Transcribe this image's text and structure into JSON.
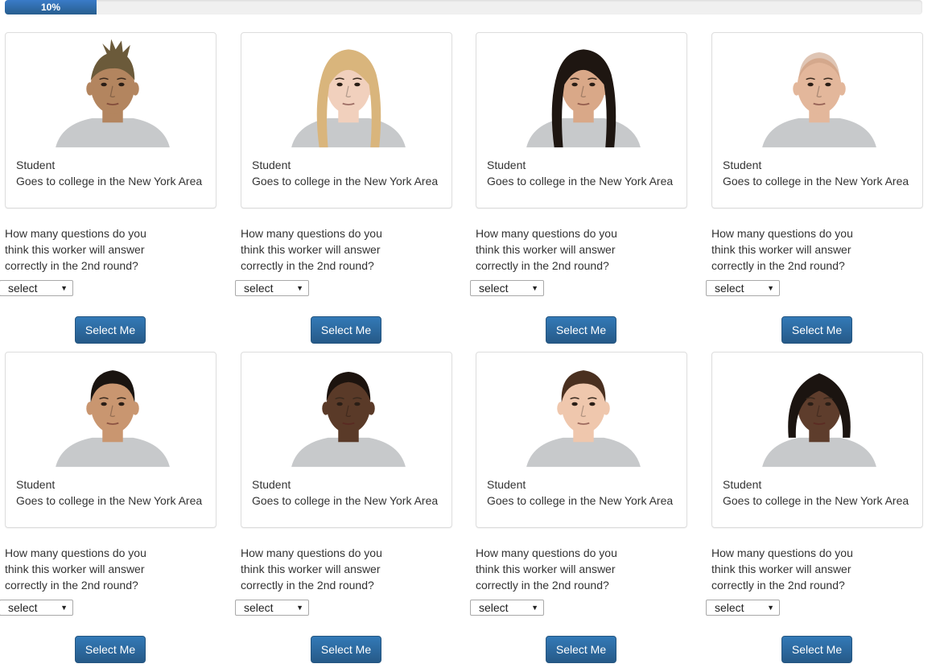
{
  "progress": {
    "label": "10%",
    "value_percent": 10
  },
  "workers": [
    {
      "role": "Student",
      "desc": "Goes to college in the New York Area",
      "question": "How many questions do you think this worker will answer correctly in the 2nd round?",
      "select_value": "select",
      "button_label": "Select Me",
      "skin": "#b3855f",
      "hair": "#6b5a3a",
      "hair_style": "mohawk"
    },
    {
      "role": "Student",
      "desc": "Goes to college in the New York Area",
      "question": "How many questions do you think this worker will answer correctly in the 2nd round?",
      "select_value": "select",
      "button_label": "Select Me",
      "skin": "#f1d0bd",
      "hair": "#d9b57c",
      "hair_style": "long"
    },
    {
      "role": "Student",
      "desc": "Goes to college in the New York Area",
      "question": "How many questions do you think this worker will answer correctly in the 2nd round?",
      "select_value": "select",
      "button_label": "Select Me",
      "skin": "#d9a888",
      "hair": "#1e1611",
      "hair_style": "long"
    },
    {
      "role": "Student",
      "desc": "Goes to college in the New York Area",
      "question": "How many questions do you think this worker will answer correctly in the 2nd round?",
      "select_value": "select",
      "button_label": "Select Me",
      "skin": "#e3b79b",
      "hair": "#c99e82",
      "hair_style": "bald"
    },
    {
      "role": "Student",
      "desc": "Goes to college in the New York Area",
      "question": "How many questions do you think this worker will answer correctly in the 2nd round?",
      "select_value": "select",
      "button_label": "Select Me",
      "skin": "#c99670",
      "hair": "#1a1410",
      "hair_style": "short"
    },
    {
      "role": "Student",
      "desc": "Goes to college in the New York Area",
      "question": "How many questions do you think this worker will answer correctly in the 2nd round?",
      "select_value": "select",
      "button_label": "Select Me",
      "skin": "#5a3a28",
      "hair": "#1c130e",
      "hair_style": "buzz"
    },
    {
      "role": "Student",
      "desc": "Goes to college in the New York Area",
      "question": "How many questions do you think this worker will answer correctly in the 2nd round?",
      "select_value": "select",
      "button_label": "Select Me",
      "skin": "#efc7ad",
      "hair": "#4a3020",
      "hair_style": "short"
    },
    {
      "role": "Student",
      "desc": "Goes to college in the New York Area",
      "question": "How many questions do you think this worker will answer correctly in the 2nd round?",
      "select_value": "select",
      "button_label": "Select Me",
      "skin": "#5e3d2c",
      "hair": "#1b1410",
      "hair_style": "bob"
    }
  ]
}
